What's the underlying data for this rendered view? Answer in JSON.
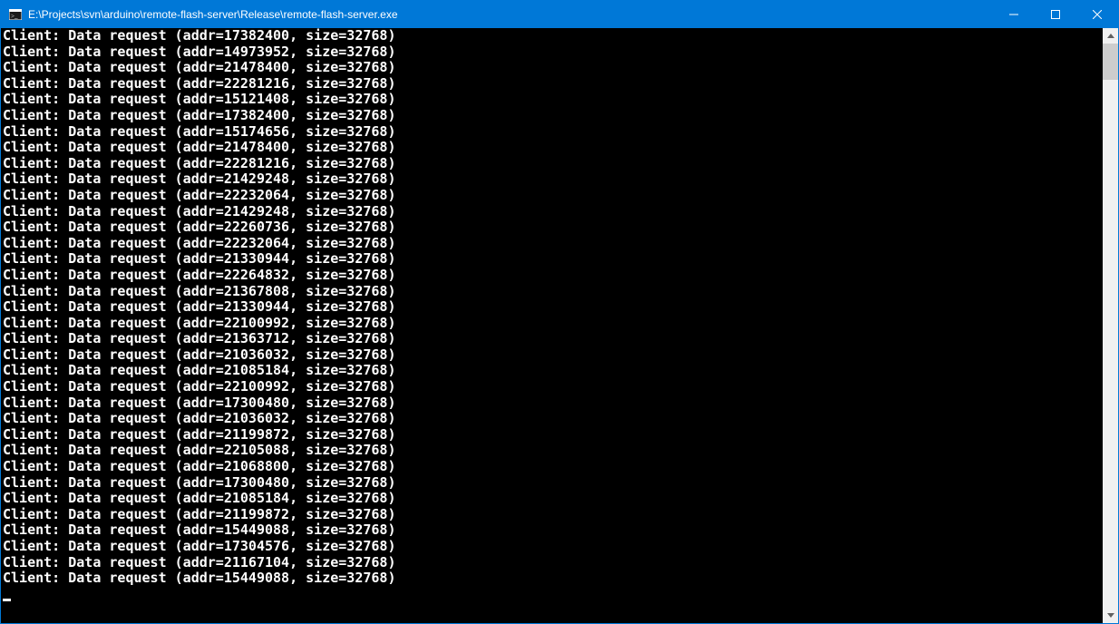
{
  "window": {
    "title": "E:\\Projects\\svn\\arduino\\remote-flash-server\\Release\\remote-flash-server.exe"
  },
  "log": {
    "prefix": "Client: Data request",
    "size_label": "size",
    "addr_label": "addr",
    "default_size": 32768,
    "lines": [
      {
        "addr": 17382400,
        "size": 32768
      },
      {
        "addr": 14973952,
        "size": 32768
      },
      {
        "addr": 21478400,
        "size": 32768
      },
      {
        "addr": 22281216,
        "size": 32768
      },
      {
        "addr": 15121408,
        "size": 32768
      },
      {
        "addr": 17382400,
        "size": 32768
      },
      {
        "addr": 15174656,
        "size": 32768
      },
      {
        "addr": 21478400,
        "size": 32768
      },
      {
        "addr": 22281216,
        "size": 32768
      },
      {
        "addr": 21429248,
        "size": 32768
      },
      {
        "addr": 22232064,
        "size": 32768
      },
      {
        "addr": 21429248,
        "size": 32768
      },
      {
        "addr": 22260736,
        "size": 32768
      },
      {
        "addr": 22232064,
        "size": 32768
      },
      {
        "addr": 21330944,
        "size": 32768
      },
      {
        "addr": 22264832,
        "size": 32768
      },
      {
        "addr": 21367808,
        "size": 32768
      },
      {
        "addr": 21330944,
        "size": 32768
      },
      {
        "addr": 22100992,
        "size": 32768
      },
      {
        "addr": 21363712,
        "size": 32768
      },
      {
        "addr": 21036032,
        "size": 32768
      },
      {
        "addr": 21085184,
        "size": 32768
      },
      {
        "addr": 22100992,
        "size": 32768
      },
      {
        "addr": 17300480,
        "size": 32768
      },
      {
        "addr": 21036032,
        "size": 32768
      },
      {
        "addr": 21199872,
        "size": 32768
      },
      {
        "addr": 22105088,
        "size": 32768
      },
      {
        "addr": 21068800,
        "size": 32768
      },
      {
        "addr": 17300480,
        "size": 32768
      },
      {
        "addr": 21085184,
        "size": 32768
      },
      {
        "addr": 21199872,
        "size": 32768
      },
      {
        "addr": 15449088,
        "size": 32768
      },
      {
        "addr": 17304576,
        "size": 32768
      },
      {
        "addr": 21167104,
        "size": 32768
      },
      {
        "addr": 15449088,
        "size": 32768
      }
    ]
  }
}
